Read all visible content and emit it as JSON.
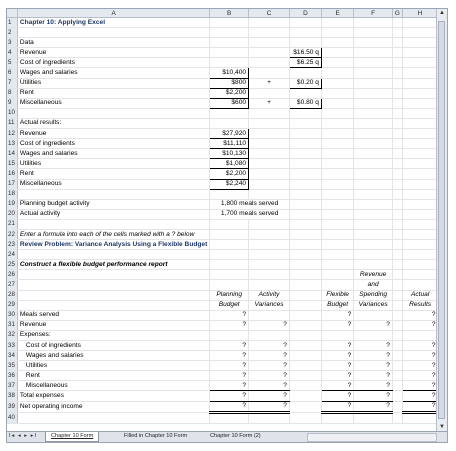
{
  "columns": [
    "",
    "A",
    "B",
    "C",
    "D",
    "E",
    "F",
    "G",
    "H",
    "I"
  ],
  "title": "Chapter 10: Applying Excel",
  "data_header": "Data",
  "data_rows": [
    {
      "label": "Revenue",
      "d": "$16.50 q"
    },
    {
      "label": "Cost of ingredients",
      "d": "$6.25 q"
    },
    {
      "label": "Wages and salaries",
      "b": "$10,400"
    },
    {
      "label": "Utilities",
      "b": "$800",
      "c": "+",
      "d": "$0.20 q"
    },
    {
      "label": "Rent",
      "b": "$2,200"
    },
    {
      "label": "Miscellaneous",
      "b": "$600",
      "c": "+",
      "d": "$0.80 q"
    }
  ],
  "actual_header": "Actual results:",
  "actual_rows": [
    {
      "label": "Revenue",
      "b": "$27,920"
    },
    {
      "label": "Cost of ingredients",
      "b": "$11,110"
    },
    {
      "label": "Wages and salaries",
      "b": "$10,130"
    },
    {
      "label": "Utilities",
      "b": "$1,080"
    },
    {
      "label": "Rent",
      "b": "$2,200"
    },
    {
      "label": "Miscellaneous",
      "b": "$2,240"
    }
  ],
  "planning_activity": {
    "label": "Planning budget activity",
    "value": "1,800 meals served"
  },
  "actual_activity": {
    "label": "Actual activity",
    "value": "1,700 meals served"
  },
  "instruction": "Enter a formula into each of the cells marked with a ? below",
  "review_title": "Review Problem: Variance Analysis Using a Flexible Budget",
  "report_title": "Construct a flexible budget performance report",
  "report_headers": {
    "revenue_and": [
      "Revenue",
      "and"
    ],
    "planning": [
      "Planning",
      "Budget"
    ],
    "activity": [
      "Activity",
      "Variances"
    ],
    "flexible": [
      "Flexible",
      "Budget"
    ],
    "spending": [
      "Spending",
      "Variances"
    ],
    "actual": [
      "Actual",
      "Results"
    ]
  },
  "meals_served": "Meals served",
  "report_revenue": "Revenue",
  "expenses_label": "Expenses:",
  "expense_items": [
    "Cost of ingredients",
    "Wages and salaries",
    "Utilities",
    "Rent",
    "Miscellaneous"
  ],
  "total_expenses": "Total expenses",
  "net_income": "Net operating income",
  "placeholder": "?",
  "sheet_tabs": [
    "Chapter 10 Form",
    "Filled in Chapter 10 Form",
    "Chapter 10 Form (2)"
  ],
  "nav_buttons": "I◂ ◂ ▸ ▸I"
}
